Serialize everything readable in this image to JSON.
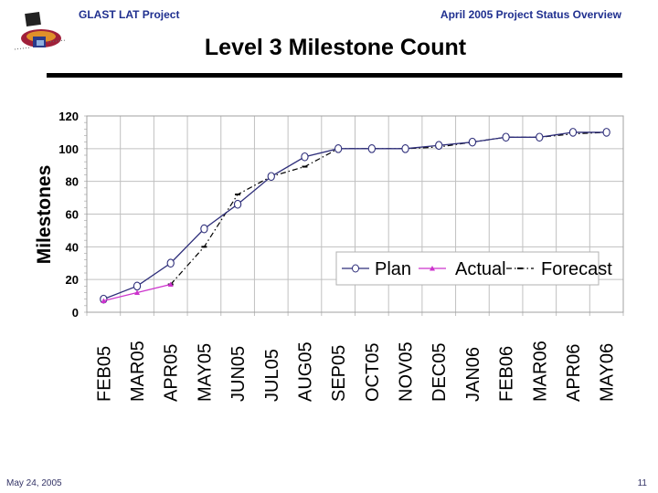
{
  "header": {
    "left_title": "GLAST LAT Project",
    "right_title": "April 2005 Project Status Overview",
    "logo_icon": "glast-logo-icon"
  },
  "slide": {
    "title": "Level 3 Milestone Count"
  },
  "footer": {
    "date": "May 24, 2005",
    "page_number": "11"
  },
  "colors": {
    "header_text": "#1f2f8f",
    "plan": "#2e2e7a",
    "actual": "#cc33cc",
    "forecast": "#000000",
    "grid": "#c0c0c0"
  },
  "chart_data": {
    "type": "line",
    "title": "Level 3 Milestone Count",
    "xlabel": "",
    "ylabel": "Milestones",
    "ylim": [
      0,
      120
    ],
    "yticks": [
      0,
      20,
      40,
      60,
      80,
      100,
      120
    ],
    "ytick_labels": [
      "0",
      "20",
      "40",
      "60",
      "80",
      "100",
      "120"
    ],
    "grid": true,
    "legend_position": "lower-right",
    "categories": [
      "FEB05",
      "MAR05",
      "APR05",
      "MAY05",
      "JUN05",
      "JUL05",
      "AUG05",
      "SEP05",
      "OCT05",
      "NOV05",
      "DEC05",
      "JAN06",
      "FEB06",
      "MAR06",
      "APR06",
      "MAY06"
    ],
    "series": [
      {
        "name": "Plan",
        "marker": "circle",
        "style": "solid",
        "values": [
          8,
          16,
          30,
          51,
          66,
          83,
          95,
          100,
          100,
          100,
          102,
          104,
          107,
          107,
          110,
          110
        ]
      },
      {
        "name": "Actual",
        "marker": "triangle",
        "style": "solid",
        "values": [
          7,
          12,
          17,
          null,
          null,
          null,
          null,
          null,
          null,
          null,
          null,
          null,
          null,
          null,
          null,
          null
        ]
      },
      {
        "name": "Forecast",
        "marker": "dash",
        "style": "dash-dot",
        "values": [
          null,
          null,
          17,
          40,
          72,
          83,
          89,
          100,
          100,
          100,
          101,
          104,
          107,
          107,
          109,
          110
        ]
      }
    ]
  }
}
